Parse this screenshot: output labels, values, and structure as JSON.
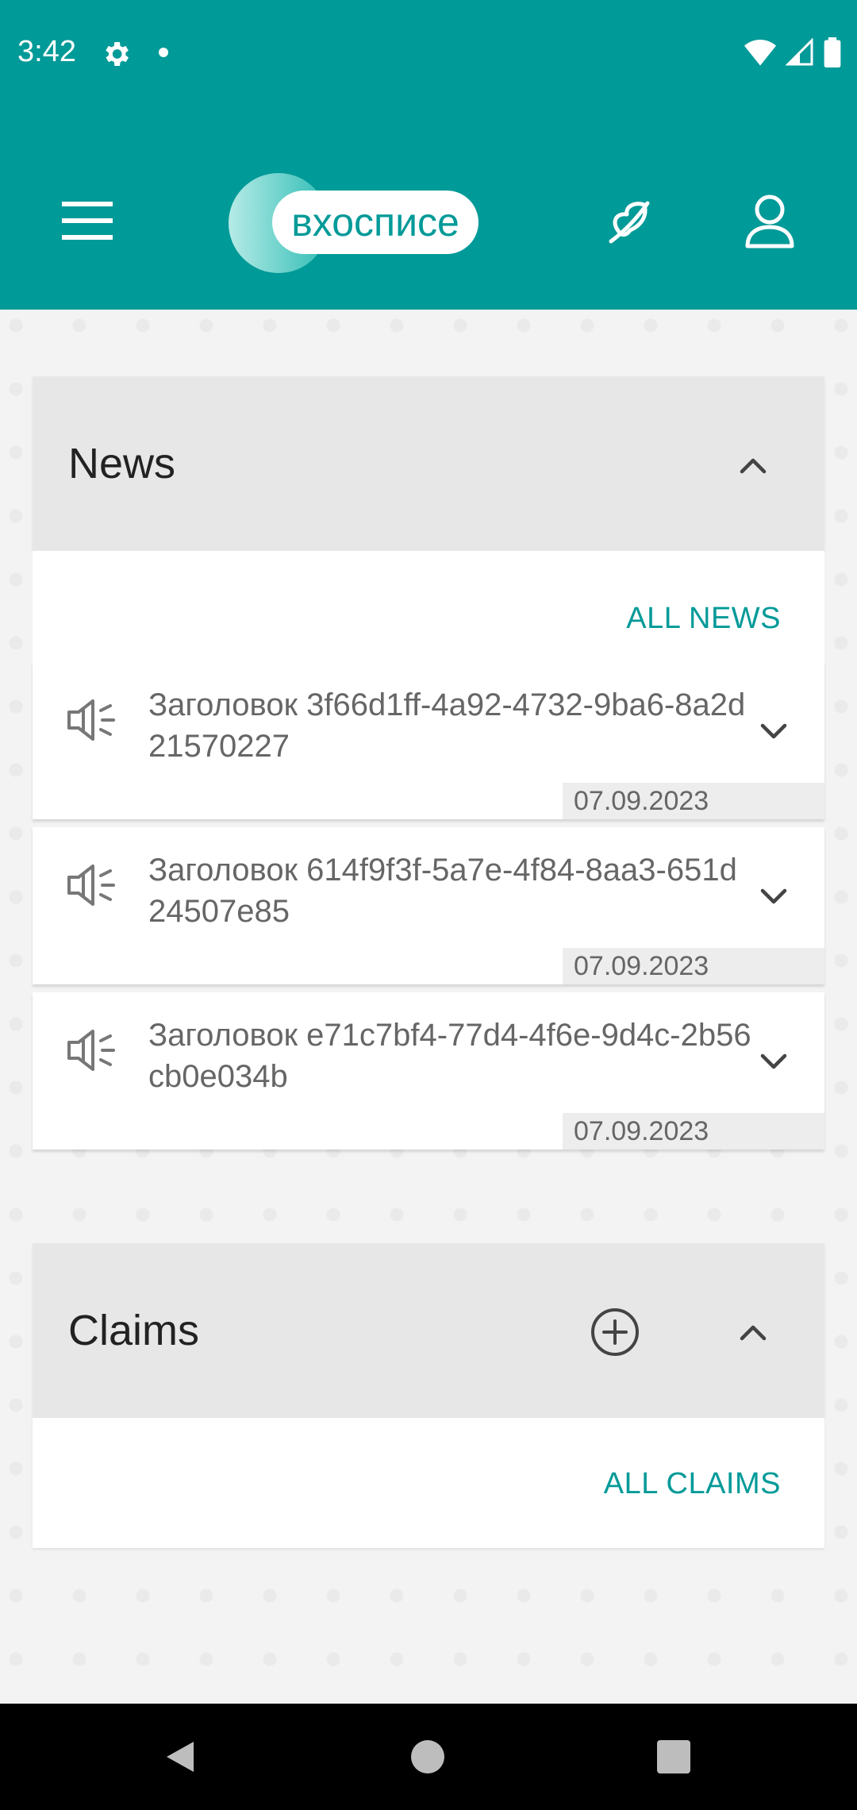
{
  "status_bar": {
    "time": "3:42",
    "icons": [
      "gear-icon",
      "dot-icon",
      "wifi-icon",
      "signal-icon",
      "battery-icon"
    ]
  },
  "app_bar": {
    "logo_text": "вхосписе",
    "icons": [
      "menu-icon",
      "feather-icon",
      "profile-icon"
    ],
    "color": "#009a98"
  },
  "news": {
    "title": "News",
    "all_link": "ALL NEWS",
    "items": [
      {
        "title": "Заголовок 3f66d1ff-4a92-4732-9ba6-8a2d21570227",
        "date": "07.09.2023"
      },
      {
        "title": "Заголовок 614f9f3f-5a7e-4f84-8aa3-651d24507e85",
        "date": "07.09.2023"
      },
      {
        "title": "Заголовок e71c7bf4-77d4-4f6e-9d4c-2b56cb0e034b",
        "date": "07.09.2023"
      }
    ]
  },
  "claims": {
    "title": "Claims",
    "all_link": "ALL CLAIMS"
  },
  "nav_bar": {
    "icons": [
      "back-icon",
      "home-icon",
      "recents-icon"
    ]
  }
}
